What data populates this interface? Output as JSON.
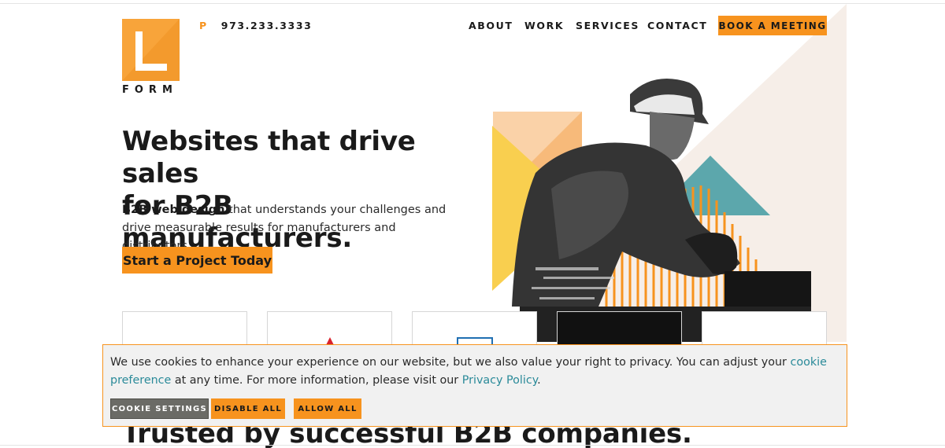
{
  "header": {
    "logo_word": "FORM",
    "phone_prefix": "P",
    "phone_number": "973.233.3333",
    "nav": [
      "ABOUT",
      "WORK",
      "SERVICES",
      "CONTACT"
    ],
    "book_label": "BOOK A MEETING"
  },
  "hero": {
    "headline_line1": "Websites that drive sales",
    "headline_line2": "for B2B manufacturers.",
    "subcopy_bold": "B2B web design",
    "subcopy_rest": " that understands your challenges and drive measurable results for manufacturers and distributors.",
    "cta_label": "Start a Project Today"
  },
  "trusted_heading": "Trusted by successful B2B companies.",
  "cookie": {
    "text_before": "We use cookies to enhance your experience on our website, but we also value your right to privacy. You can adjust your ",
    "link1": "cookie preference",
    "text_middle": " at any time. For more information, please visit our ",
    "link2": "Privacy Policy",
    "text_after": ".",
    "settings_label": "COOKIE SETTINGS",
    "disable_label": "DISABLE ALL",
    "allow_label": "ALLOW ALL"
  },
  "colors": {
    "accent": "#f7931e",
    "link": "#2a8a99",
    "teal_shape": "#5ca7ac",
    "yellow_shape": "#f9cf4f",
    "wedge": "#f6eee8"
  },
  "icons": {
    "hero_image": "worker-with-grinder-illustration"
  }
}
